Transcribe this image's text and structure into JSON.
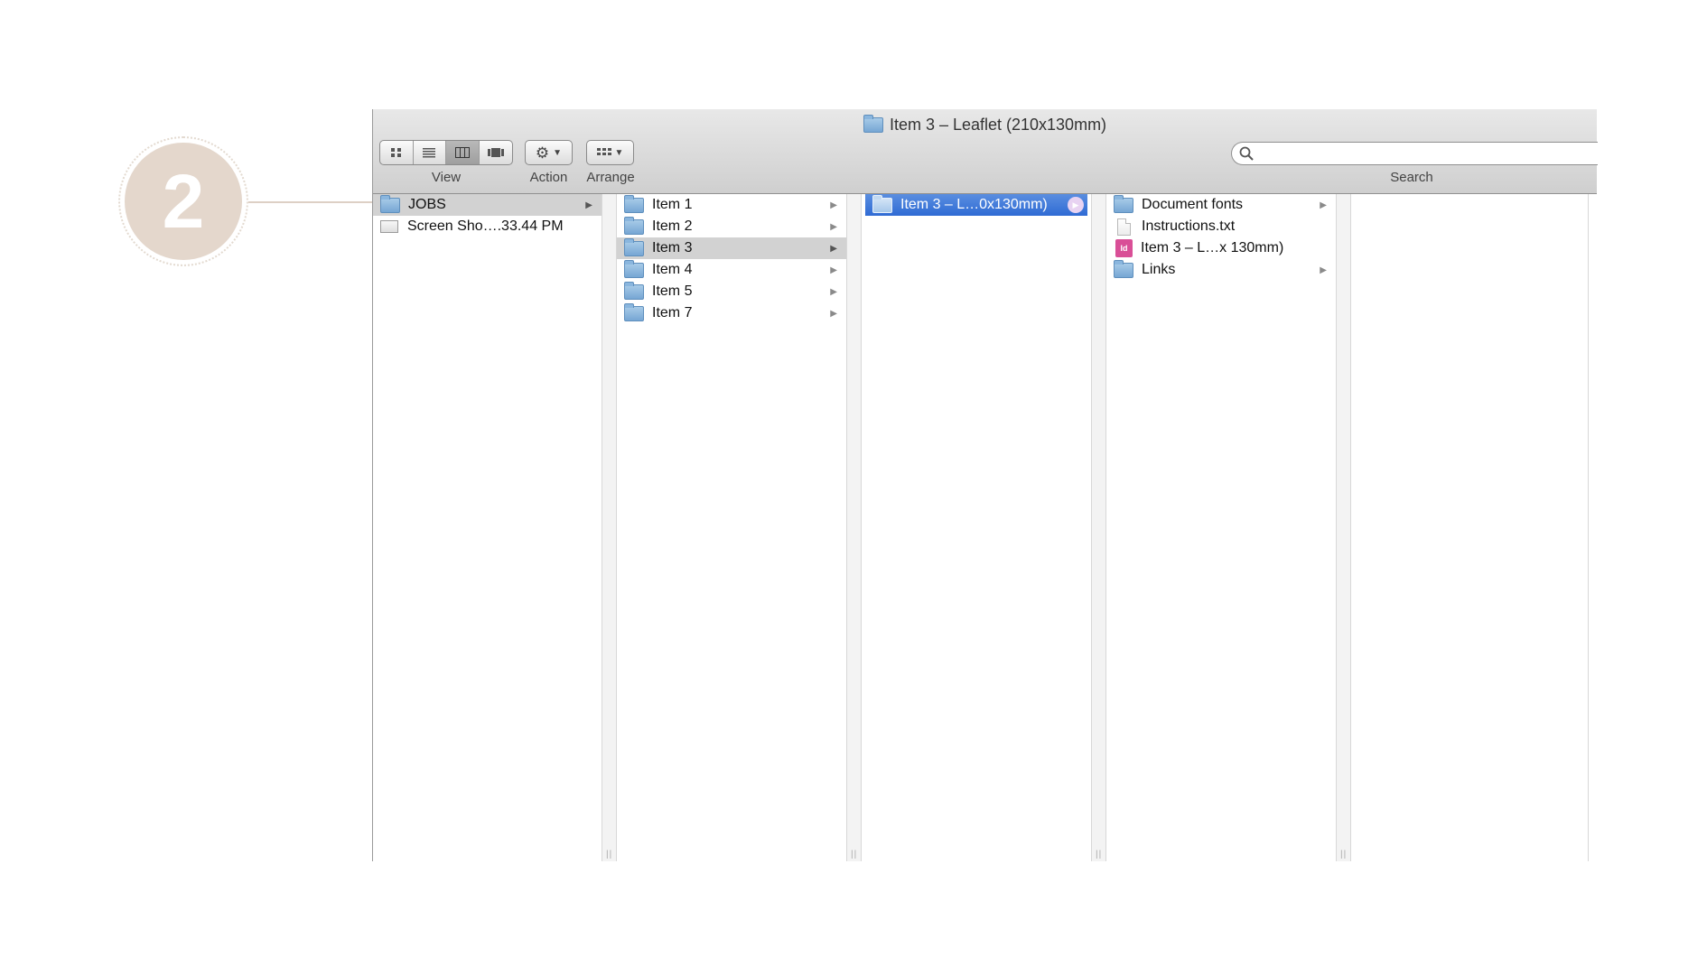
{
  "step": {
    "number": "2"
  },
  "window": {
    "title": "Item 3 – Leaflet (210x130mm)"
  },
  "toolbar": {
    "view_label": "View",
    "action_label": "Action",
    "arrange_label": "Arrange",
    "search_label": "Search",
    "search_placeholder": "",
    "view_icons": [
      "icon-view-icon",
      "list-view-icon",
      "column-view-icon",
      "coverflow-view-icon"
    ],
    "action_icon": "gear-icon",
    "arrange_icon": "grid-arrange-icon"
  },
  "columns": {
    "col1": [
      {
        "label": "JOBS",
        "icon": "folder-icon",
        "arrow": "▶"
      },
      {
        "label": "Screen Sho….33.44 PM",
        "icon": "screenshot-file-icon"
      }
    ],
    "col2": [
      {
        "label": "Item 1",
        "icon": "folder-icon",
        "arrow": "▶"
      },
      {
        "label": "Item 2",
        "icon": "folder-icon",
        "arrow": "▶"
      },
      {
        "label": "Item 3",
        "icon": "folder-icon",
        "arrow": "▶"
      },
      {
        "label": "Item 4",
        "icon": "folder-icon",
        "arrow": "▶"
      },
      {
        "label": "Item 5",
        "icon": "folder-icon",
        "arrow": "▶"
      },
      {
        "label": "Item 7",
        "icon": "folder-icon",
        "arrow": "▶"
      }
    ],
    "col3": [
      {
        "label": "Item 3 – L…0x130mm)",
        "icon": "folder-icon",
        "arrow": "▶"
      }
    ],
    "col4": [
      {
        "label": "Document fonts",
        "icon": "folder-icon",
        "arrow": "▶"
      },
      {
        "label": "Instructions.txt",
        "icon": "text-file-icon"
      },
      {
        "label": "Item 3 – L…x 130mm)",
        "icon": "indesign-file-icon",
        "badge": "Id"
      },
      {
        "label": "Links",
        "icon": "folder-icon",
        "arrow": "▶"
      }
    ]
  },
  "colors": {
    "step_badge": "#e4d7cc",
    "selection_blue": "#2f6bd4",
    "selection_gray": "#d2d2d2"
  }
}
